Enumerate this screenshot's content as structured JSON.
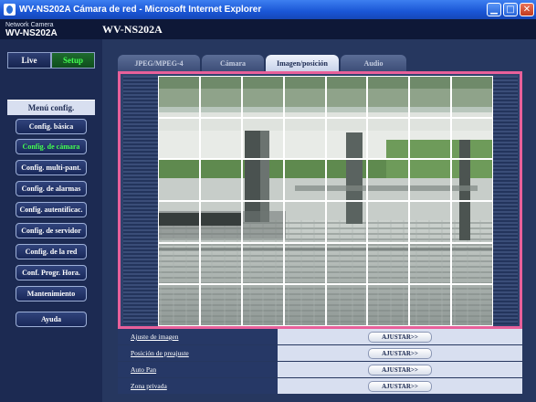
{
  "window": {
    "title": "WV-NS202A Cámara de red - Microsoft Internet Explorer",
    "minimize_glyph": "▁",
    "maximize_glyph": "□",
    "close_glyph": "✕"
  },
  "header": {
    "brand_small": "Network Camera",
    "brand_model": "WV-NS202A",
    "model_title": "WV-NS202A"
  },
  "sidebar": {
    "live_label": "Live",
    "setup_label": "Setup",
    "menu_title": "Menú config.",
    "items": [
      {
        "label": "Config. básica"
      },
      {
        "label": "Config. de cámara"
      },
      {
        "label": "Config. multi-pant."
      },
      {
        "label": "Config. de alarmas"
      },
      {
        "label": "Config. autentificac."
      },
      {
        "label": "Config. de servidor"
      },
      {
        "label": "Config. de la red"
      },
      {
        "label": "Conf. Progr. Hora."
      },
      {
        "label": "Mantenimiento"
      },
      {
        "label": "Ayuda"
      }
    ]
  },
  "tabs": [
    {
      "label": "JPEG/MPEG-4"
    },
    {
      "label": "Cámara"
    },
    {
      "label": "Imagen/posición"
    },
    {
      "label": "Audio"
    }
  ],
  "settings": [
    {
      "label": "Ajuste de imagen",
      "button": "AJUSTAR>>"
    },
    {
      "label": "Posición de preajuste",
      "button": "AJUSTAR>>"
    },
    {
      "label": "Auto Pan",
      "button": "AJUSTAR>>"
    },
    {
      "label": "Zona privada",
      "button": "AJUSTAR>>"
    }
  ],
  "colors": {
    "accent_active": "#43ff52",
    "highlight_border": "#e8609a",
    "titlebar": "#1a56d6"
  }
}
